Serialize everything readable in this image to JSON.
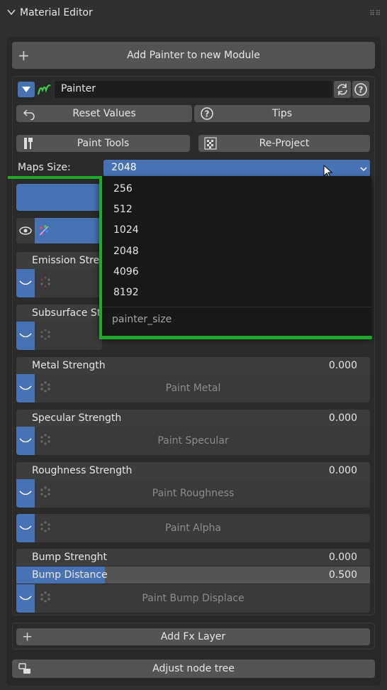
{
  "panel": {
    "title": "Material Editor"
  },
  "top_button": {
    "label": "Add Painter to new Module"
  },
  "module": {
    "name": "Painter",
    "reset_label": "Reset Values",
    "tips_label": "Tips",
    "paint_tools_label": "Paint Tools",
    "reproject_label": "Re-Project",
    "maps_size_label": "Maps Size:",
    "maps_size_value": "2048"
  },
  "dropdown": {
    "options": [
      "256",
      "512",
      "1024",
      "2048",
      "4096",
      "8192"
    ],
    "footer": "painter_size"
  },
  "channels": [
    {
      "label": "Emission Stre",
      "button": ""
    },
    {
      "label": "Subsurface St",
      "button": ""
    },
    {
      "label": "Metal Strength",
      "value": "0.000",
      "button": "Paint Metal"
    },
    {
      "label": "Specular Strength",
      "value": "0.000",
      "button": "Paint Specular"
    },
    {
      "label": "Roughness Strength",
      "value": "0.000",
      "button": "Paint Roughness"
    },
    {
      "button": "Paint Alpha"
    },
    {
      "label": "Bump Strenght",
      "value": "0.000"
    },
    {
      "label": "Bump Distance",
      "value": "0.500",
      "fill": 0.25
    },
    {
      "button": "Paint Bump Displace"
    }
  ],
  "fx_button": {
    "label": "Add Fx Layer"
  },
  "bottom_button": {
    "label": "Adjust node tree"
  },
  "colors": {
    "accent": "#4772b3",
    "highlight": "#1faa2c"
  }
}
